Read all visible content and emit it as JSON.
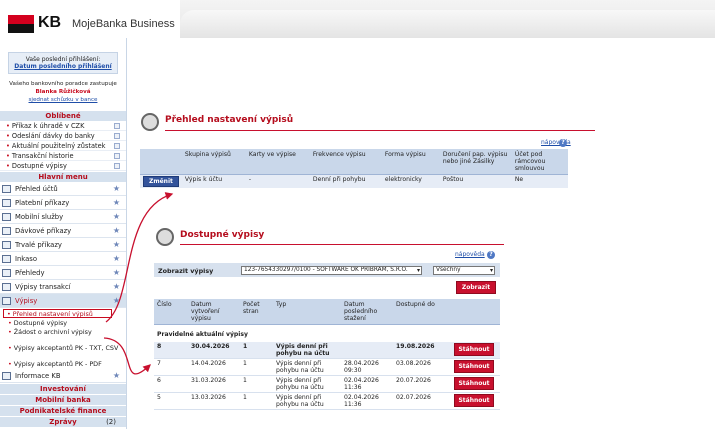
{
  "app": {
    "brand": "KB",
    "title": "MojeBanka Business"
  },
  "login": {
    "label": "Vaše poslední přihlášení:",
    "link": "Datum posledního přihlášení"
  },
  "advisor": {
    "label": "Vašeho bankovního poradce zastupuje",
    "name": "Blanka Růžičková",
    "link": "sjednat schůzku v bance"
  },
  "sidebar": {
    "favorites_title": "Oblíbené",
    "favorites": [
      "Příkaz k úhradě v CZK",
      "Odeslání dávky do banky",
      "Aktuální použitelný zůstatek",
      "Transakční historie",
      "Dostupné výpisy"
    ],
    "main_title": "Hlavní menu",
    "menu": [
      "Přehled účtů",
      "Platební příkazy",
      "Mobilní služby",
      "Dávkové příkazy",
      "Trvalé příkazy",
      "Inkaso",
      "Přehledy",
      "Výpisy transakcí",
      "Výpisy"
    ],
    "sub": [
      "Přehled nastavení výpisů",
      "Dostupné výpisy",
      "Žádost o archivní výpisy",
      "Výpisy akceptantů PK - TXT, CSV",
      "Výpisy akceptantů PK - PDF"
    ],
    "info": "Informace KB",
    "bottom": [
      "Investování",
      "Mobilní banka",
      "Podnikatelské finance"
    ],
    "messages": {
      "label": "Zprávy",
      "count": "(2)"
    }
  },
  "settings_panel": {
    "title": "Přehled nastavení výpisů",
    "help": "nápověda",
    "headers": [
      "Skupina výpisů",
      "Karty ve výpise",
      "Frekvence výpisu",
      "Forma výpisu",
      "Doručení pap. výpisu nebo jiné Zásilky",
      "Účet pod rámcovou smlouvou"
    ],
    "button": "Změnit",
    "row": [
      "Výpis k účtu",
      "-",
      "Denní při pohybu",
      "elektronicky",
      "Poštou",
      "Ne"
    ]
  },
  "available_panel": {
    "title": "Dostupné výpisy",
    "help": "nápověda",
    "filter_label": "Zobrazit výpisy",
    "account": "123-7654330297/0100 - SOFTWARE OK PŘÍBRAM, S.R.O.",
    "scope": "Všechny",
    "show_button": "Zobrazit",
    "headers": [
      "Číslo",
      "Datum vytvoření výpisu",
      "Počet stran",
      "Typ",
      "Datum posledního stažení",
      "Dostupné do"
    ],
    "group_label": "Pravidelné aktuální výpisy",
    "download_label": "Stáhnout",
    "rows": [
      {
        "no": "8",
        "created": "30.04.2026",
        "pages": "1",
        "type": "Výpis denní při pohybu na účtu",
        "last": "",
        "until": "19.08.2026",
        "bold": true
      },
      {
        "no": "7",
        "created": "14.04.2026",
        "pages": "1",
        "type": "Výpis denní při pohybu na účtu",
        "last": "28.04.2026 09:30",
        "until": "03.08.2026",
        "bold": false
      },
      {
        "no": "6",
        "created": "31.03.2026",
        "pages": "1",
        "type": "Výpis denní při pohybu na účtu",
        "last": "02.04.2026 11:36",
        "until": "20.07.2026",
        "bold": false
      },
      {
        "no": "5",
        "created": "13.03.2026",
        "pages": "1",
        "type": "Výpis denní při pohybu na účtu",
        "last": "02.04.2026 11:36",
        "until": "02.07.2026",
        "bold": false
      }
    ]
  },
  "colors": {
    "brand_red": "#d4001e",
    "accent_blue": "#33539b",
    "button_red": "#c8102e",
    "sidebar_bg": "#d5e1ee"
  }
}
